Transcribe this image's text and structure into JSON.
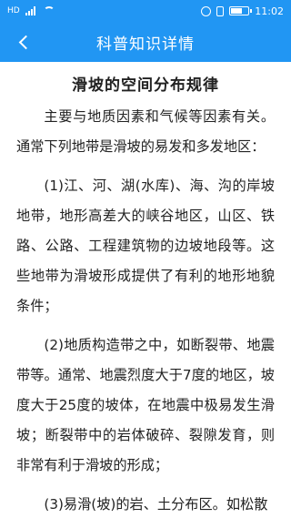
{
  "status_bar": {
    "sim": "HD",
    "time": "11:02",
    "battery_level": 0.75
  },
  "nav": {
    "title": "科普知识详情"
  },
  "article": {
    "title": "滑坡的空间分布规律",
    "paragraphs": [
      "主要与地质因素和气候等因素有关。通常下列地带是滑坡的易发和多发地区：",
      "(1)江、河、湖(水库)、海、沟的岸坡地带，地形高差大的峡谷地区，山区、铁路、公路、工程建筑物的边坡地段等。这些地带为滑坡形成提供了有利的地形地貌条件；",
      "(2)地质构造带之中，如断裂带、地震带等。通常、地震烈度大于7度的地区，坡度大于25度的坡体，在地震中极易发生滑坡；断裂带中的岩体破碎、裂隙发育，则非常有利于滑坡的形成；",
      "(3)易滑(坡)的岩、土分布区。如松散"
    ]
  }
}
